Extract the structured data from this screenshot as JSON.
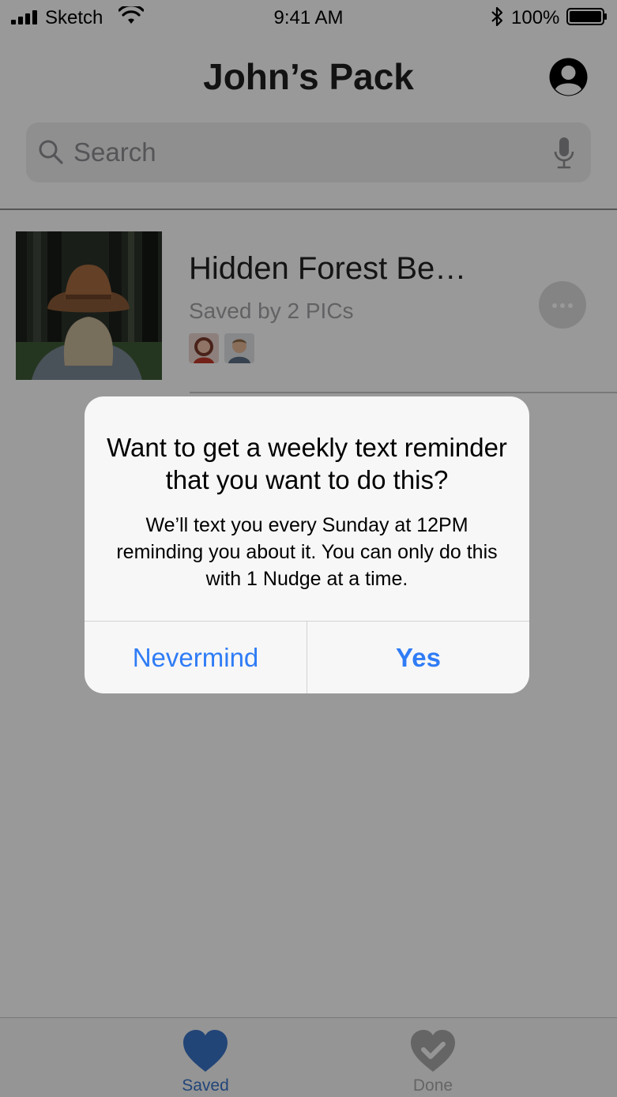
{
  "status_bar": {
    "carrier": "Sketch",
    "time": "9:41 AM",
    "battery": "100%"
  },
  "header": {
    "title": "John’s Pack",
    "profile_icon": "profile-icon"
  },
  "search": {
    "placeholder": "Search",
    "value": "",
    "icons": [
      "search-icon",
      "microphone-icon"
    ]
  },
  "list": {
    "items": [
      {
        "title": "Hidden Forest Be…",
        "subtitle": "Saved by 2 PICs",
        "thumbnail": "forest-hat-photo",
        "avatars": [
          "avatar-woman",
          "avatar-man"
        ],
        "menu_icon": "more-icon"
      }
    ]
  },
  "alert": {
    "title": "Want to get a weekly text reminder that you want to do this?",
    "message": "We’ll text you every Sunday at 12PM reminding you about it. You can only do this with 1 Nudge at a time.",
    "cancel_label": "Nevermind",
    "confirm_label": "Yes"
  },
  "tab_bar": {
    "tabs": [
      {
        "label": "Saved",
        "icon": "heart-icon",
        "active": true
      },
      {
        "label": "Done",
        "icon": "heart-check-icon",
        "active": false
      }
    ]
  },
  "colors": {
    "accent": "#2f7cf6",
    "tab_active": "#3a73c9",
    "tab_inactive": "#a8a8a8",
    "overlay": "rgba(0,0,0,0.4)"
  }
}
